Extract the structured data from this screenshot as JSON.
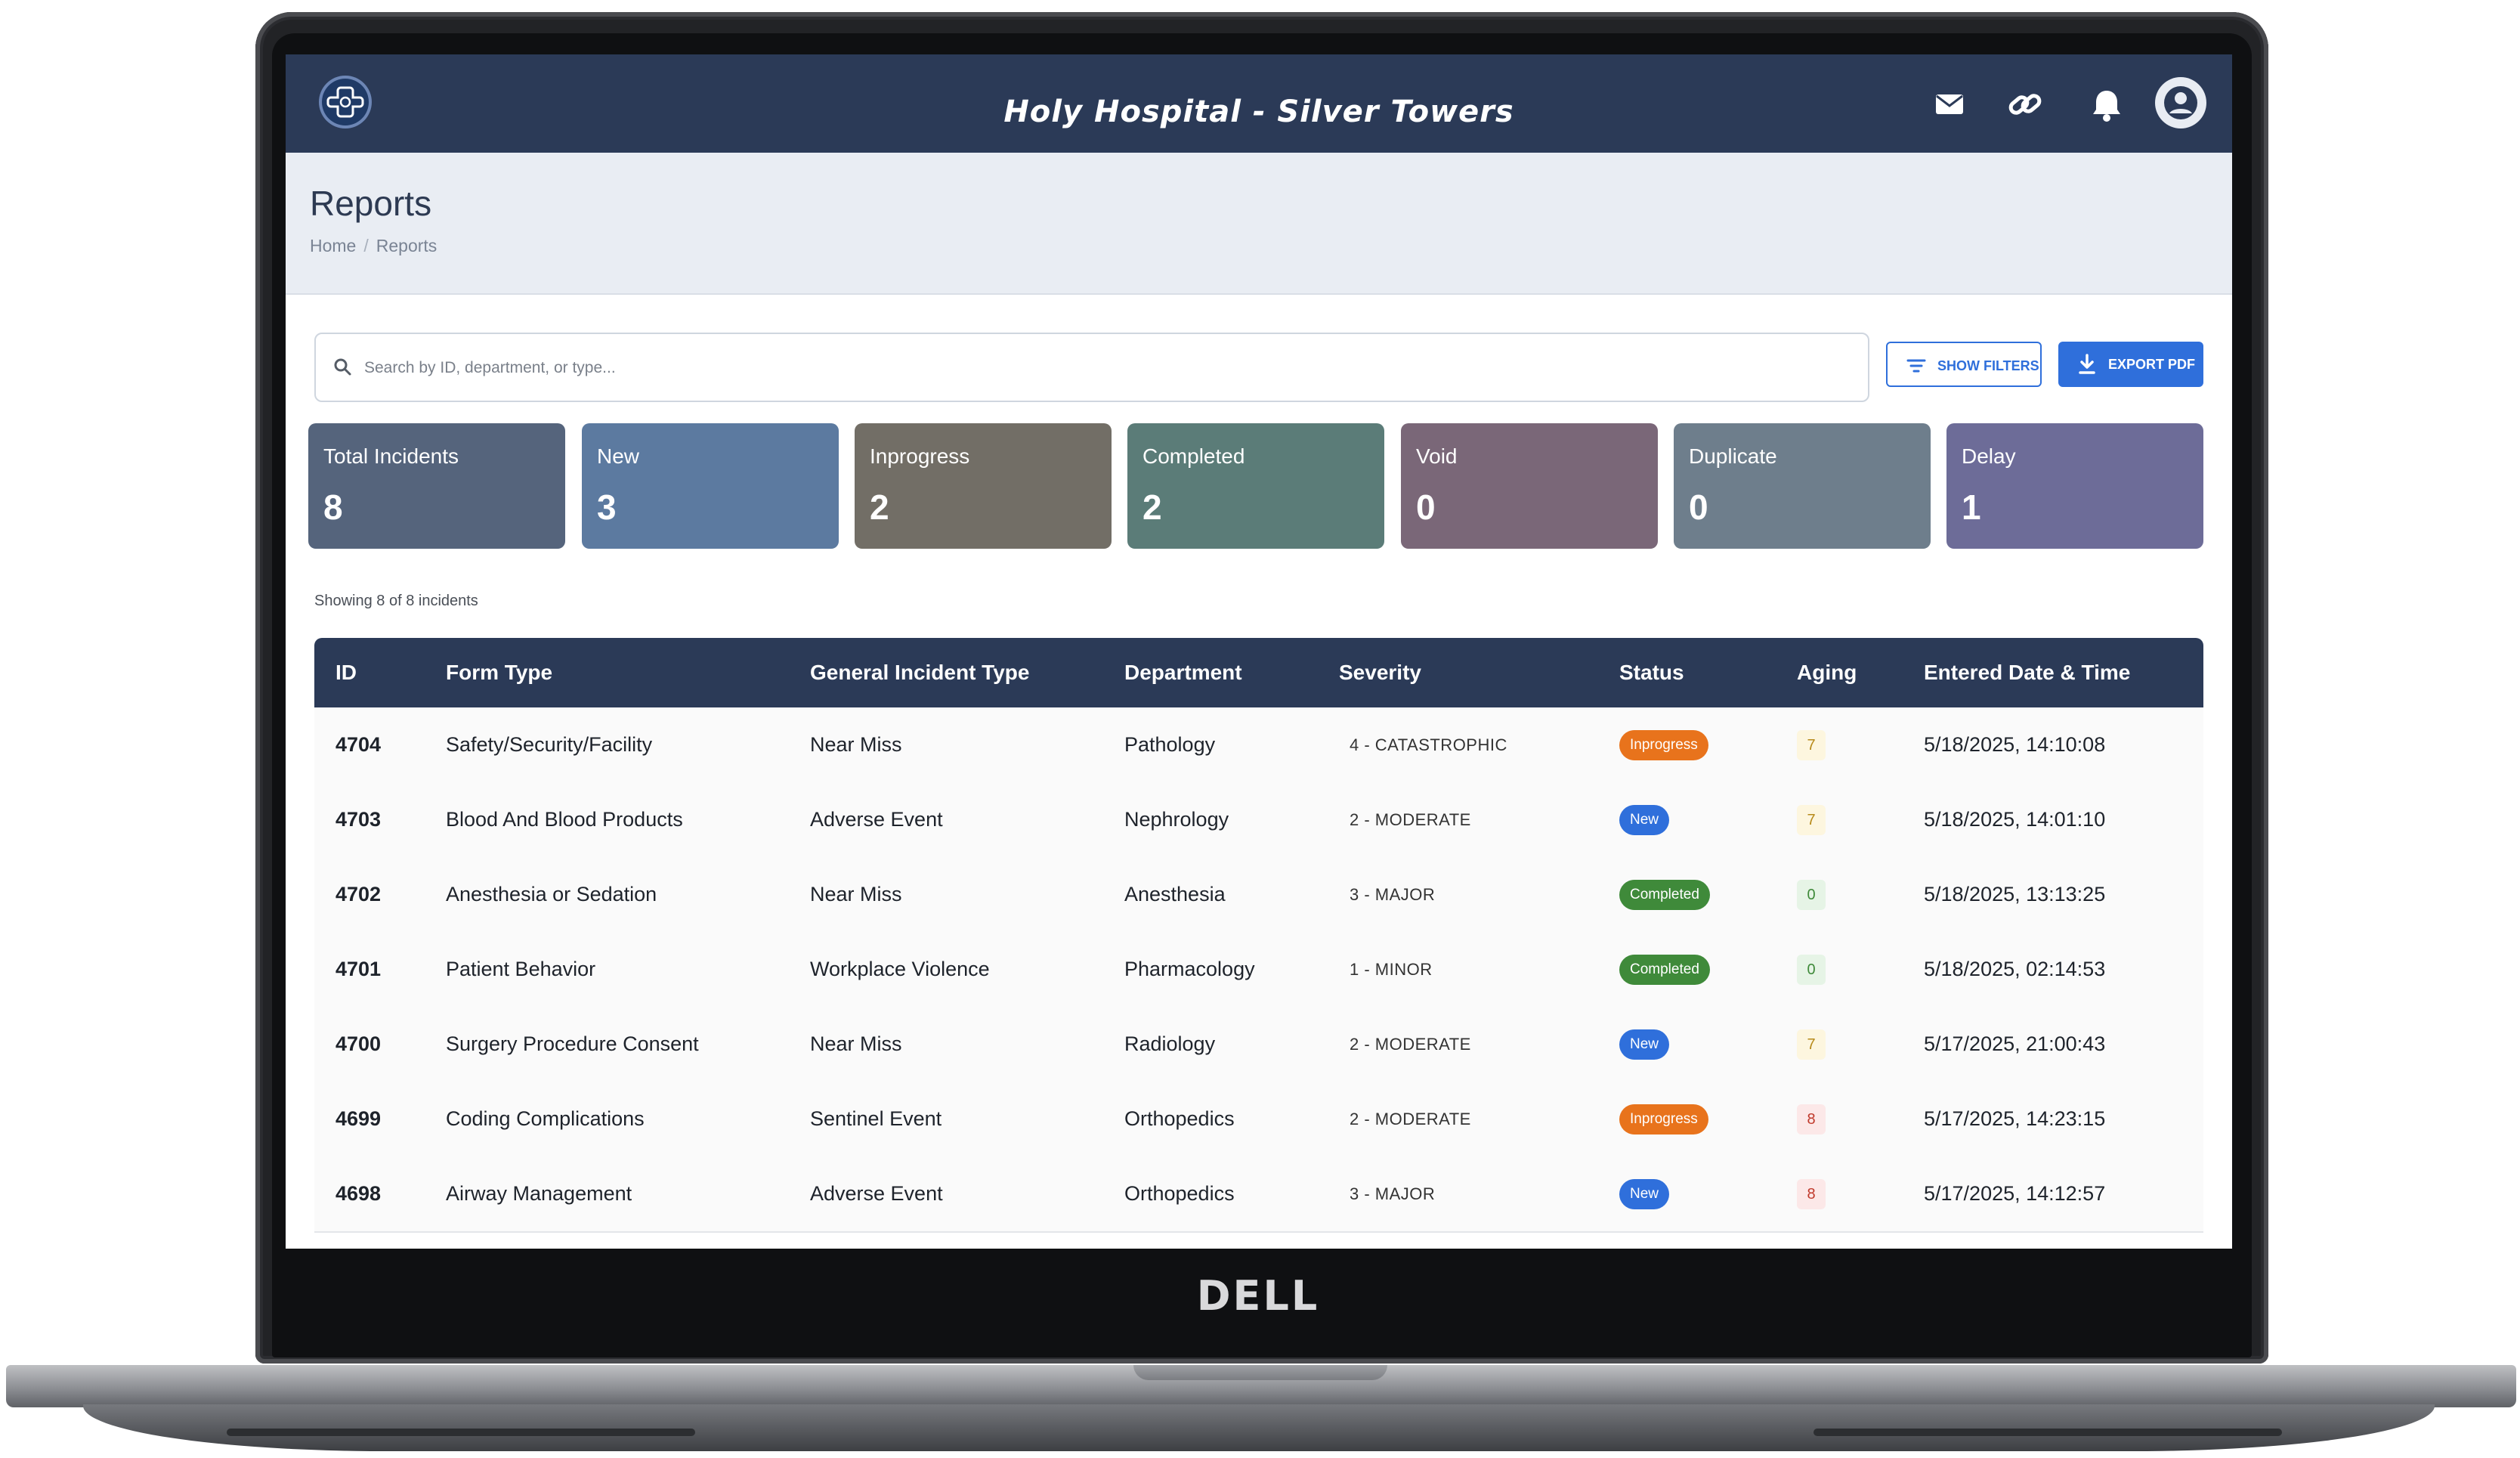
{
  "device": {
    "brand": "DELL"
  },
  "app": {
    "title": "Holy Hospital - Silver Towers"
  },
  "header": {
    "page_title": "Reports",
    "breadcrumb": [
      "Home",
      "Reports"
    ]
  },
  "search": {
    "placeholder": "Search by ID, department, or type..."
  },
  "actions": {
    "show_filters": "SHOW FILTERS",
    "export_pdf": "EXPORT PDF"
  },
  "summary_cards": [
    {
      "label": "Total Incidents",
      "value": "8",
      "color": "#55647c"
    },
    {
      "label": "New",
      "value": "3",
      "color": "#5c7aa0"
    },
    {
      "label": "Inprogress",
      "value": "2",
      "color": "#726e66"
    },
    {
      "label": "Completed",
      "value": "2",
      "color": "#5b7c78"
    },
    {
      "label": "Void",
      "value": "0",
      "color": "#7a6778"
    },
    {
      "label": "Duplicate",
      "value": "0",
      "color": "#6e7e8c"
    },
    {
      "label": "Delay",
      "value": "1",
      "color": "#6d6c98"
    }
  ],
  "showing_text": "Showing 8 of 8 incidents",
  "table": {
    "columns": [
      "ID",
      "Form Type",
      "General Incident Type",
      "Department",
      "Severity",
      "Status",
      "Aging",
      "Entered Date & Time"
    ],
    "rows": [
      {
        "id": "4704",
        "form_type": "Safety/Security/Facility",
        "incident_type": "Near Miss",
        "department": "Pathology",
        "severity": "4 - CATASTROPHIC",
        "status": "Inprogress",
        "aging": "7",
        "entered": "5/18/2025, 14:10:08"
      },
      {
        "id": "4703",
        "form_type": "Blood And Blood Products",
        "incident_type": "Adverse Event",
        "department": "Nephrology",
        "severity": "2 - MODERATE",
        "status": "New",
        "aging": "7",
        "entered": "5/18/2025, 14:01:10"
      },
      {
        "id": "4702",
        "form_type": "Anesthesia or Sedation",
        "incident_type": "Near Miss",
        "department": "Anesthesia",
        "severity": "3 - MAJOR",
        "status": "Completed",
        "aging": "0",
        "entered": "5/18/2025, 13:13:25"
      },
      {
        "id": "4701",
        "form_type": "Patient Behavior",
        "incident_type": "Workplace Violence",
        "department": "Pharmacology",
        "severity": "1 - MINOR",
        "status": "Completed",
        "aging": "0",
        "entered": "5/18/2025, 02:14:53"
      },
      {
        "id": "4700",
        "form_type": "Surgery Procedure Consent",
        "incident_type": "Near Miss",
        "department": "Radiology",
        "severity": "2 - MODERATE",
        "status": "New",
        "aging": "7",
        "entered": "5/17/2025, 21:00:43"
      },
      {
        "id": "4699",
        "form_type": "Coding Complications",
        "incident_type": "Sentinel Event",
        "department": "Orthopedics",
        "severity": "2 - MODERATE",
        "status": "Inprogress",
        "aging": "8",
        "entered": "5/17/2025, 14:23:15"
      },
      {
        "id": "4698",
        "form_type": "Airway Management",
        "incident_type": "Adverse Event",
        "department": "Orthopedics",
        "severity": "3 - MAJOR",
        "status": "New",
        "aging": "8",
        "entered": "5/17/2025, 14:12:57"
      }
    ]
  },
  "status_colors": {
    "Inprogress": "#e8731c",
    "New": "#2f6fdb",
    "Completed": "#3f8a3a"
  },
  "aging_colors": {
    "7": {
      "bg": "#fdf6df",
      "fg": "#b78a1a"
    },
    "0": {
      "bg": "#e6f4e6",
      "fg": "#3f8a3a"
    },
    "8": {
      "bg": "#fce8e8",
      "fg": "#c0392b"
    }
  }
}
